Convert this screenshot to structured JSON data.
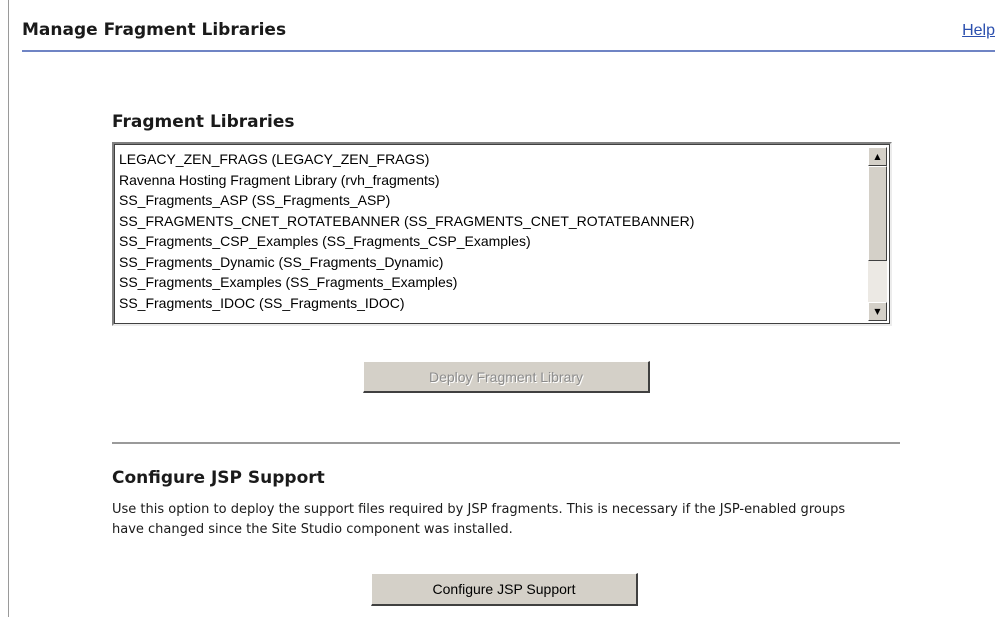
{
  "header": {
    "title": "Manage Fragment Libraries",
    "help_label": "Help"
  },
  "fragment_libraries": {
    "heading": "Fragment Libraries",
    "items": [
      "LEGACY_ZEN_FRAGS (LEGACY_ZEN_FRAGS)",
      "Ravenna Hosting Fragment Library (rvh_fragments)",
      "SS_Fragments_ASP (SS_Fragments_ASP)",
      "SS_FRAGMENTS_CNET_ROTATEBANNER (SS_FRAGMENTS_CNET_ROTATEBANNER)",
      "SS_Fragments_CSP_Examples (SS_Fragments_CSP_Examples)",
      "SS_Fragments_Dynamic (SS_Fragments_Dynamic)",
      "SS_Fragments_Examples (SS_Fragments_Examples)",
      "SS_Fragments_IDOC (SS_Fragments_IDOC)"
    ],
    "deploy_button_label": "Deploy Fragment Library"
  },
  "jsp_support": {
    "heading": "Configure JSP Support",
    "description": "Use this option to deploy the support files required by JSP fragments. This is necessary if the JSP-enabled groups have changed since the Site Studio component was installed.",
    "button_label": "Configure JSP Support"
  },
  "icons": {
    "scroll_up": "scroll-up-arrow-icon",
    "scroll_down": "scroll-down-arrow-icon"
  },
  "colors": {
    "link": "#2b4fae",
    "title_rule": "#6f84c4",
    "button_face": "#d4d0c8"
  }
}
